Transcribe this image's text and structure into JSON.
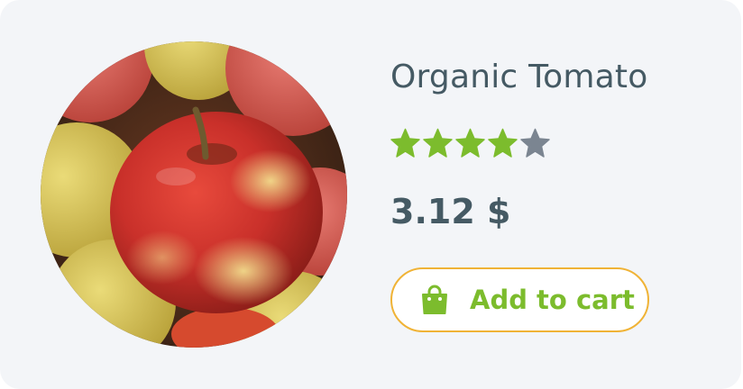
{
  "product": {
    "name": "Organic Tomato",
    "image_icon": "apple-photo",
    "rating": 4,
    "rating_max": 5,
    "price": "3.12 $",
    "add_to_cart_label": "Add to cart"
  },
  "colors": {
    "card_background": "#f3f5f8",
    "text": "#455a64",
    "star_filled": "#7cbc2d",
    "star_empty": "#7b8591",
    "button_border": "#f0b336",
    "button_text": "#7cbc2d"
  }
}
